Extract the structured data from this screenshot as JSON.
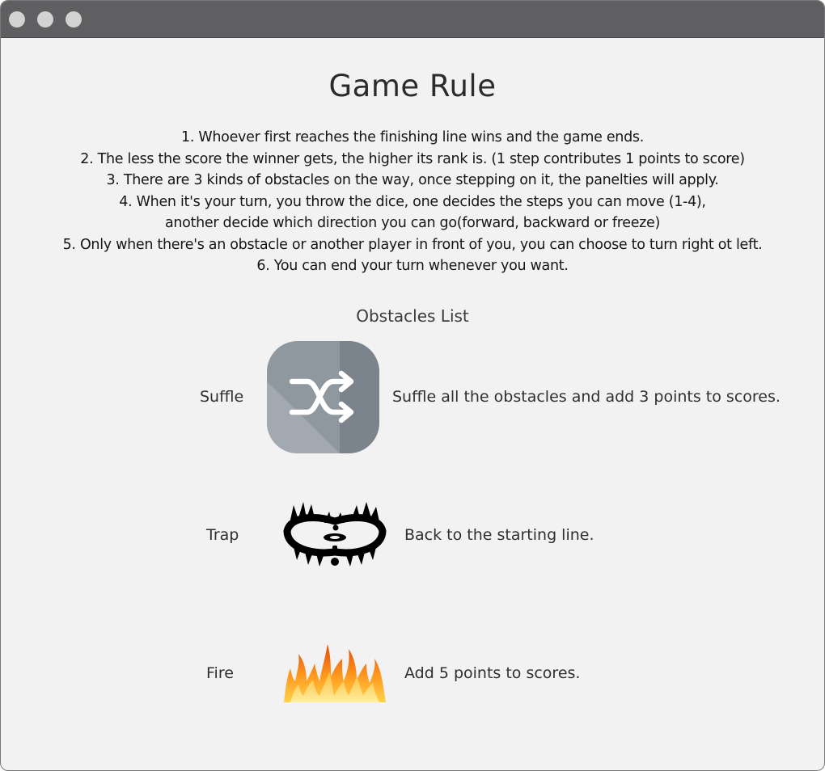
{
  "window": {
    "controls": [
      "close",
      "minimize",
      "maximize"
    ]
  },
  "title": "Game Rule",
  "rules": [
    "1. Whoever first reaches the finishing line wins and the game ends.",
    "2. The less the score the winner gets, the higher its rank is. (1 step contributes 1 points to score)",
    "3. There are 3  kinds of obstacles on the way, once stepping on it, the panelties will apply.",
    "4. When it's your turn, you throw the dice, one decides the steps you can move (1-4),",
    "another decide which direction you can go(forward, backward or freeze)",
    "5. Only when there's an obstacle or another player in front of you, you can choose to turn right ot left.",
    "6. You can end your turn whenever you want."
  ],
  "obstacles_title": "Obstacles List",
  "obstacles": [
    {
      "name": "Suffle",
      "icon": "shuffle-icon",
      "description": "Suffle all the obstacles and add 3 points to scores."
    },
    {
      "name": "Trap",
      "icon": "bear-trap-icon",
      "description": "Back to the starting line."
    },
    {
      "name": "Fire",
      "icon": "fire-icon",
      "description": "Add 5 points to scores."
    }
  ],
  "colors": {
    "titlebar": "#5f5f61",
    "window_bg": "#f2f2f2",
    "shuffle_tile": "#8f979f"
  }
}
